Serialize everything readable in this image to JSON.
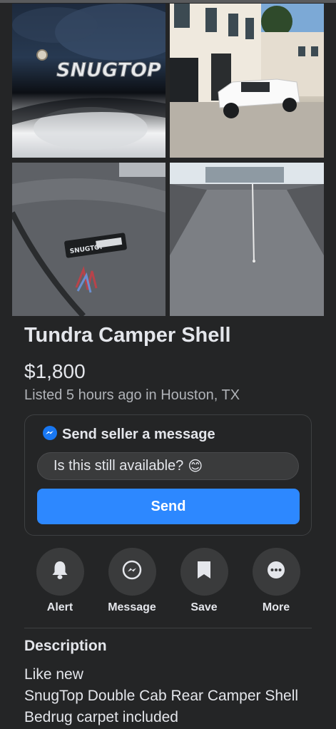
{
  "listing": {
    "title": "Tundra Camper Shell",
    "price": "$1,800",
    "listed": "Listed 5 hours ago in Houston, TX"
  },
  "photos": [
    {
      "name": "photo-snugtop-badge",
      "badge_text": "SNUGTOP"
    },
    {
      "name": "photo-white-truck-house"
    },
    {
      "name": "photo-serial-tag",
      "tag_text": "SNUGTOP"
    },
    {
      "name": "photo-truck-bed-carpet"
    }
  ],
  "message": {
    "heading": "Send seller a message",
    "input_value": "Is this still available?",
    "emoji": "😊",
    "send_label": "Send",
    "send_color": "#2d88ff"
  },
  "actions": [
    {
      "label": "Alert",
      "icon": "bell-icon"
    },
    {
      "label": "Message",
      "icon": "messenger-icon"
    },
    {
      "label": "Save",
      "icon": "bookmark-icon"
    },
    {
      "label": "More",
      "icon": "more-icon"
    }
  ],
  "description": {
    "heading": "Description",
    "lines": [
      "Like new",
      "SnugTop Double Cab Rear Camper Shell",
      "Bedrug carpet included"
    ]
  }
}
